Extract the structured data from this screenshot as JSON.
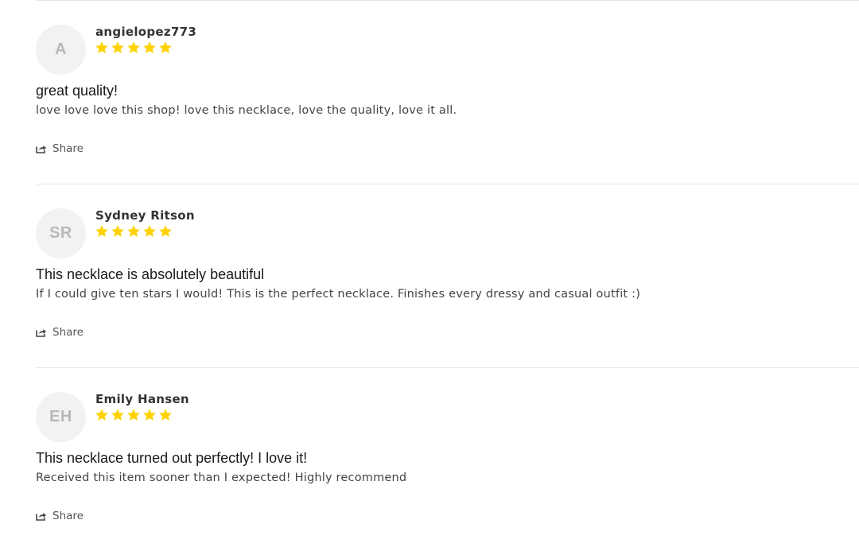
{
  "colors": {
    "star": "#FFD200",
    "avatar_bg": "#F2F2F2",
    "avatar_text": "#B8B8B8",
    "divider": "#E6E6E6"
  },
  "reviews": [
    {
      "initials": "A",
      "author": "angielopez773",
      "rating": 5,
      "title": "great quality!",
      "body": "love love love this shop! love this necklace, love the quality, love it all.",
      "share_label": "Share"
    },
    {
      "initials": "SR",
      "author": "Sydney Ritson",
      "rating": 5,
      "title": "This necklace is absolutely beautiful",
      "body": "If I could give ten stars I would! This is the perfect necklace. Finishes every dressy and casual outfit :)",
      "share_label": "Share"
    },
    {
      "initials": "EH",
      "author": "Emily Hansen",
      "rating": 5,
      "title": "This necklace turned out perfectly! I love it!",
      "body": "Received this item sooner than I expected! Highly recommend",
      "share_label": "Share"
    }
  ]
}
